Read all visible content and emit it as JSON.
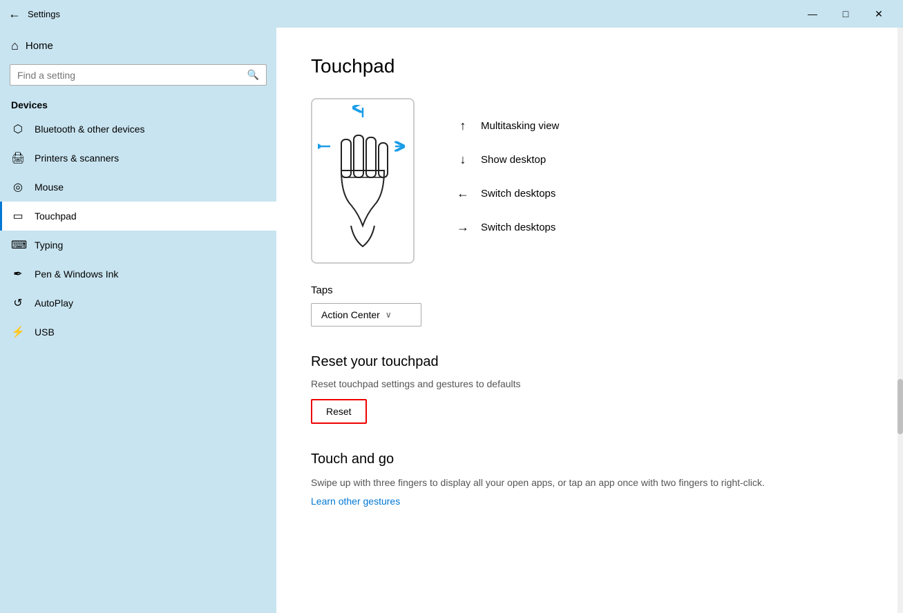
{
  "titlebar": {
    "title": "Settings",
    "back_icon": "←",
    "minimize": "—",
    "maximize": "□",
    "close": "✕"
  },
  "sidebar": {
    "home_label": "Home",
    "search_placeholder": "Find a setting",
    "section_title": "Devices",
    "items": [
      {
        "id": "bluetooth",
        "icon": "🔷",
        "label": "Bluetooth & other devices"
      },
      {
        "id": "printers",
        "icon": "🖨",
        "label": "Printers & scanners"
      },
      {
        "id": "mouse",
        "icon": "🖱",
        "label": "Mouse"
      },
      {
        "id": "touchpad",
        "icon": "⬛",
        "label": "Touchpad",
        "active": true
      },
      {
        "id": "typing",
        "icon": "⌨",
        "label": "Typing"
      },
      {
        "id": "pen",
        "icon": "✒",
        "label": "Pen & Windows Ink"
      },
      {
        "id": "autoplay",
        "icon": "▶",
        "label": "AutoPlay"
      },
      {
        "id": "usb",
        "icon": "🔌",
        "label": "USB"
      }
    ]
  },
  "content": {
    "page_title": "Touchpad",
    "gestures": [
      {
        "direction": "↑",
        "label": "Multitasking view"
      },
      {
        "direction": "↓",
        "label": "Show desktop"
      },
      {
        "direction": "←",
        "label": "Switch desktops"
      },
      {
        "direction": "→",
        "label": "Switch desktops"
      }
    ],
    "taps_label": "Taps",
    "taps_value": "Action Center",
    "reset_section": {
      "title": "Reset your touchpad",
      "description": "Reset touchpad settings and gestures to defaults",
      "button_label": "Reset"
    },
    "touch_go_section": {
      "title": "Touch and go",
      "description": "Swipe up with three fingers to display all your open apps, or tap an app once with two fingers to right-click.",
      "link_label": "Learn other gestures"
    }
  }
}
